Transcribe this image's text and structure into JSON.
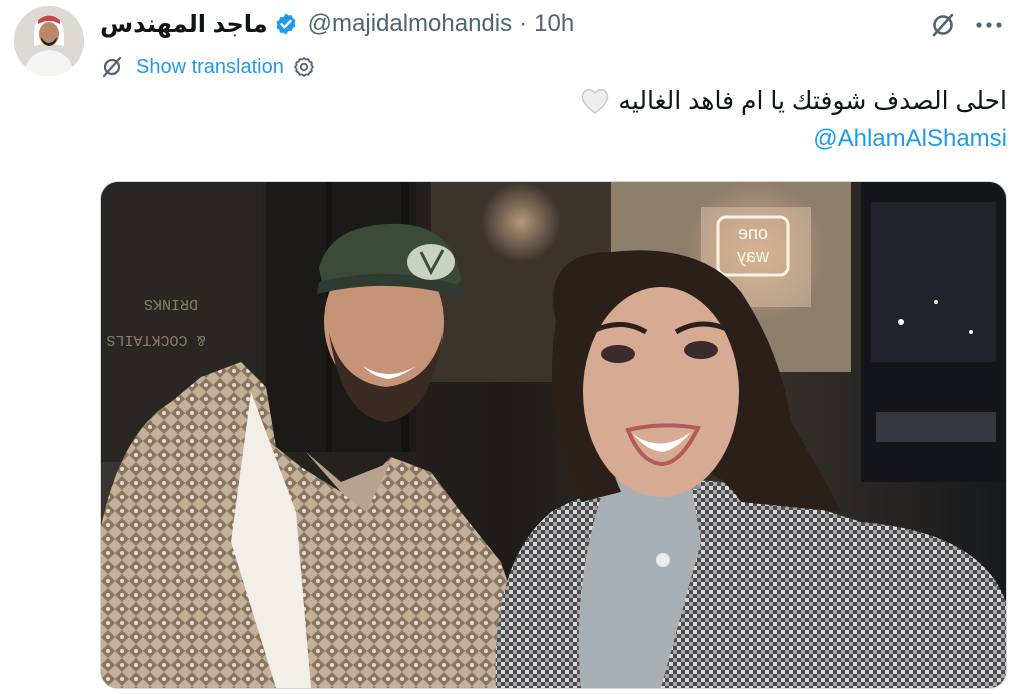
{
  "user": {
    "display_name": "ماجد المهندس",
    "handle": "@majidalmohandis",
    "separator": "·",
    "time": "10h"
  },
  "icons": {
    "verified": "verified-badge-icon",
    "grok": "grok-icon",
    "more": "more-dots-icon",
    "translate": "translate-icon",
    "settings": "gear-icon",
    "emoji": "white-heart-icon"
  },
  "translation": {
    "label": "Show translation"
  },
  "tweet": {
    "text": "احلى الصدف شوفتك يا ام فاهد الغاليه",
    "mention": "@AhlamAlShamsi"
  },
  "media": {
    "neon_sign_line1": "one",
    "neon_sign_line2": "way",
    "wall_sign_line1": "DRINKS",
    "wall_sign_line2": "& COCKTAILS"
  },
  "colors": {
    "accent": "#1d9bf0",
    "text": "#0f1419",
    "secondary": "#536471"
  }
}
